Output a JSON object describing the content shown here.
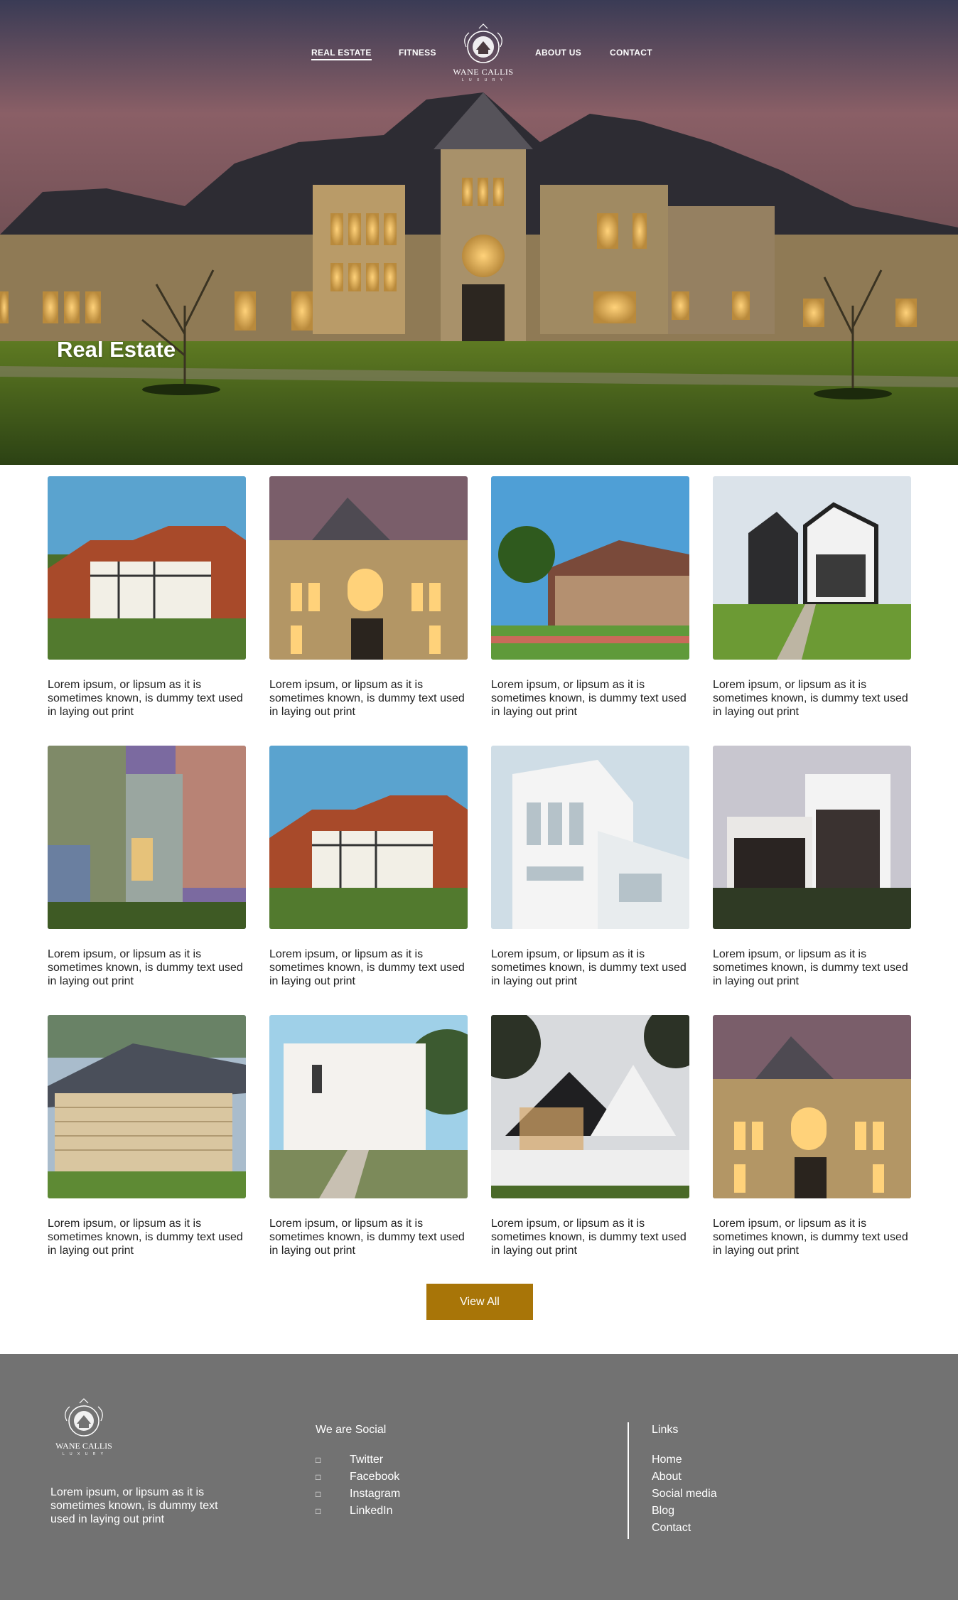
{
  "nav": {
    "items": [
      "REAL ESTATE",
      "FITNESS",
      "ABOUT US",
      "CONTACT"
    ],
    "active": "REAL ESTATE"
  },
  "logo": {
    "name": "WANE CALLIS",
    "tagline": "L U X U R Y"
  },
  "hero": {
    "title": "Real Estate"
  },
  "cards": [
    {
      "caption": "Lorem ipsum, or lipsum as it is sometimes known, is dummy text used in laying out print"
    },
    {
      "caption": "Lorem ipsum, or lipsum as it is sometimes known, is dummy text used in laying out print"
    },
    {
      "caption": "Lorem ipsum, or lipsum as it is sometimes known, is dummy text used in laying out print"
    },
    {
      "caption": "Lorem ipsum, or lipsum as it is sometimes known, is dummy text used in laying out print"
    },
    {
      "caption": "Lorem ipsum, or lipsum as it is sometimes known, is dummy text used in laying out print"
    },
    {
      "caption": "Lorem ipsum, or lipsum as it is sometimes known, is dummy text used in laying out print"
    },
    {
      "caption": "Lorem ipsum, or lipsum as it is sometimes known, is dummy text used in laying out print"
    },
    {
      "caption": "Lorem ipsum, or lipsum as it is sometimes known, is dummy text used in laying out print"
    },
    {
      "caption": "Lorem ipsum, or lipsum as it is sometimes known, is dummy text used in laying out print"
    },
    {
      "caption": "Lorem ipsum, or lipsum as it is sometimes known, is dummy text used in laying out print"
    },
    {
      "caption": "Lorem ipsum, or lipsum as it is sometimes known, is dummy text used in laying out print"
    },
    {
      "caption": "Lorem ipsum, or lipsum as it is sometimes known, is dummy text used in laying out print"
    }
  ],
  "view_all_label": "View All",
  "footer": {
    "description": "Lorem ipsum, or lipsum as it is sometimes known, is dummy text used in laying out print",
    "social_heading": "We are Social",
    "social": [
      {
        "icon": "twitter-icon",
        "label": "Twitter"
      },
      {
        "icon": "facebook-icon",
        "label": "Facebook"
      },
      {
        "icon": "instagram-icon",
        "label": "Instagram"
      },
      {
        "icon": "linkedin-icon",
        "label": "LinkedIn"
      }
    ],
    "links_heading": "Links",
    "links": [
      "Home",
      "About",
      "Social media",
      "Blog",
      "Contact"
    ]
  },
  "colors": {
    "accent": "#a87508",
    "footer_bg": "#727272"
  }
}
